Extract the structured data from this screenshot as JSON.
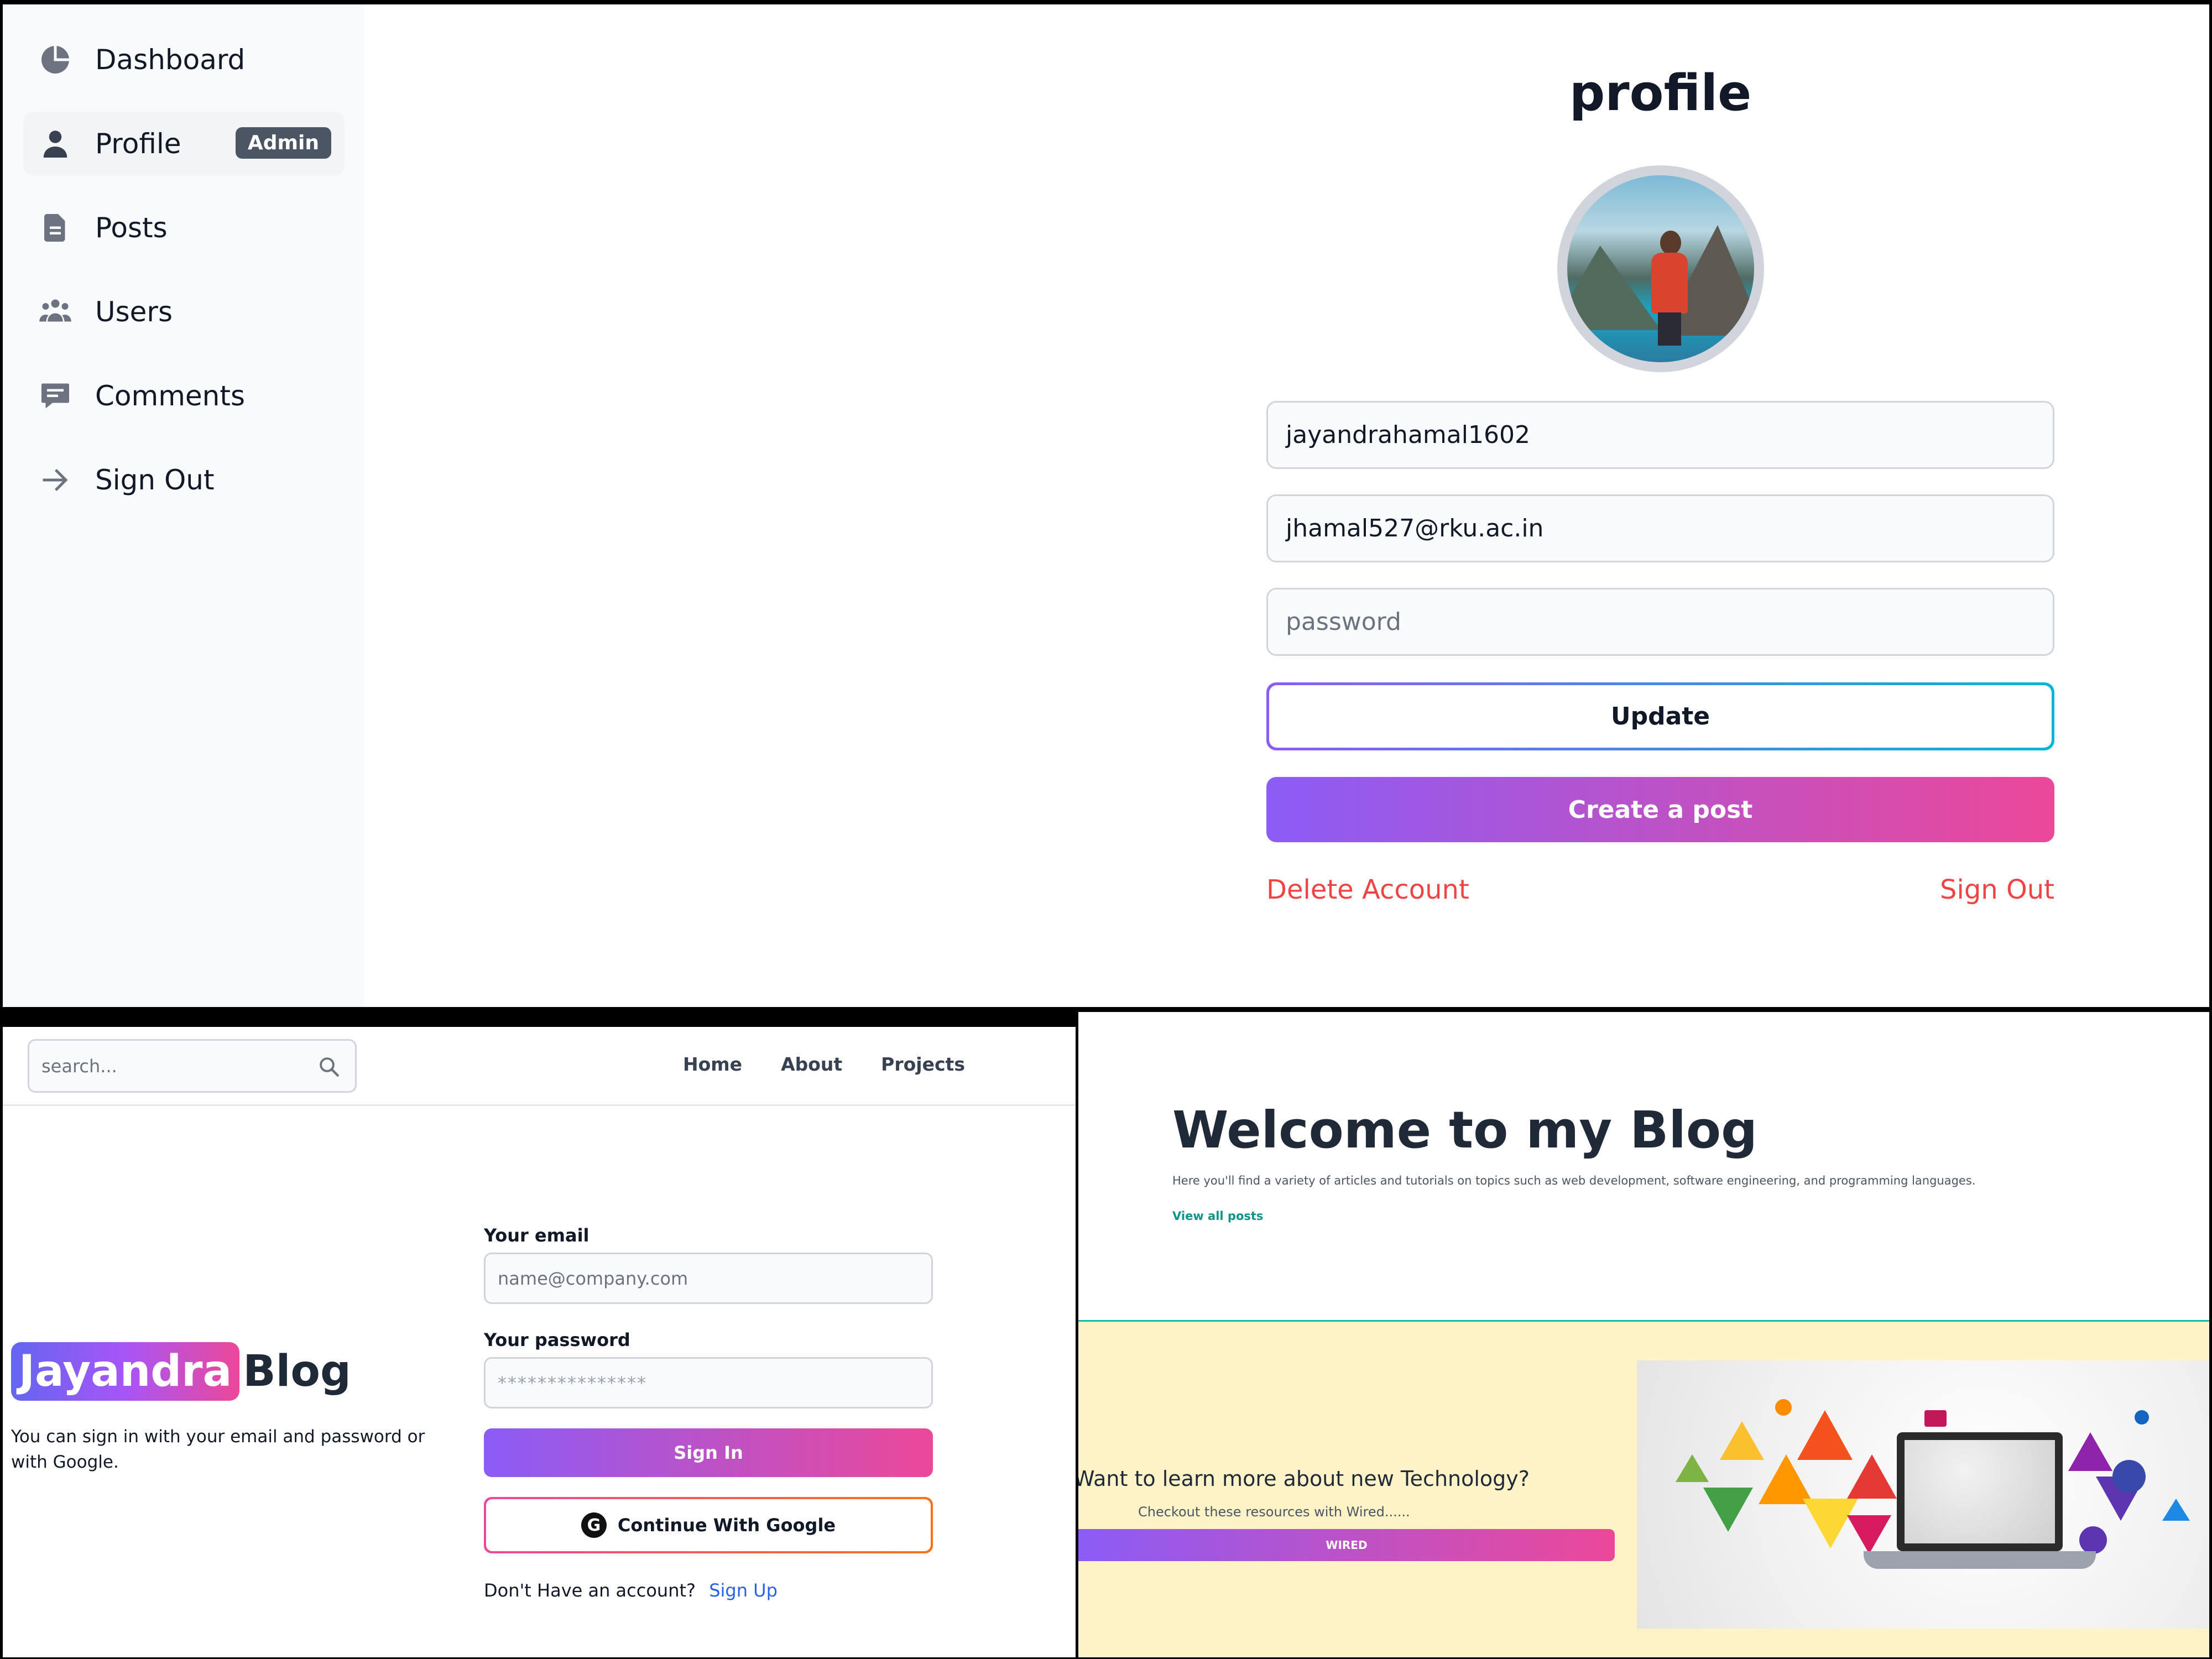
{
  "sidebar": {
    "items": [
      {
        "label": "Dashboard",
        "icon": "pie-chart-icon"
      },
      {
        "label": "Profile",
        "icon": "user-icon",
        "badge": "Admin"
      },
      {
        "label": "Posts",
        "icon": "document-icon"
      },
      {
        "label": "Users",
        "icon": "users-icon"
      },
      {
        "label": "Comments",
        "icon": "comment-icon"
      },
      {
        "label": "Sign Out",
        "icon": "arrow-right-icon"
      }
    ]
  },
  "profile": {
    "title": "profile",
    "username": "jayandrahamal1602",
    "email": "jhamal527@rku.ac.in",
    "password_placeholder": "password",
    "update_label": "Update",
    "create_post_label": "Create a post",
    "delete_label": "Delete Account",
    "signout_label": "Sign Out"
  },
  "signin_page": {
    "search_placeholder": "search...",
    "nav": [
      "Home",
      "About",
      "Projects"
    ],
    "brand_highlight": "Jayandra",
    "brand_word": "Blog",
    "note": "You can sign in with your email and password or with Google.",
    "email_label": "Your email",
    "email_placeholder": "name@company.com",
    "password_label": "Your password",
    "password_value": "***************",
    "signin_label": "Sign In",
    "google_label": "Continue With Google",
    "no_account": "Don't Have an account?",
    "signup_link": "Sign Up"
  },
  "home_page": {
    "title": "Welcome to my Blog",
    "subtitle": "Here you'll find a variety of articles and tutorials on topics such as web development, software engineering, and programming languages.",
    "view_all": "View all posts",
    "cta_question": "Want to learn more about new Technology?",
    "cta_sub": "Checkout these resources with Wired......",
    "cta_button": "WIRED"
  },
  "colors": {
    "accent_purple": "#8b5cf6",
    "accent_pink": "#ec4899",
    "danger": "#ef4444",
    "link_blue": "#2563eb",
    "teal": "#0d9488"
  }
}
